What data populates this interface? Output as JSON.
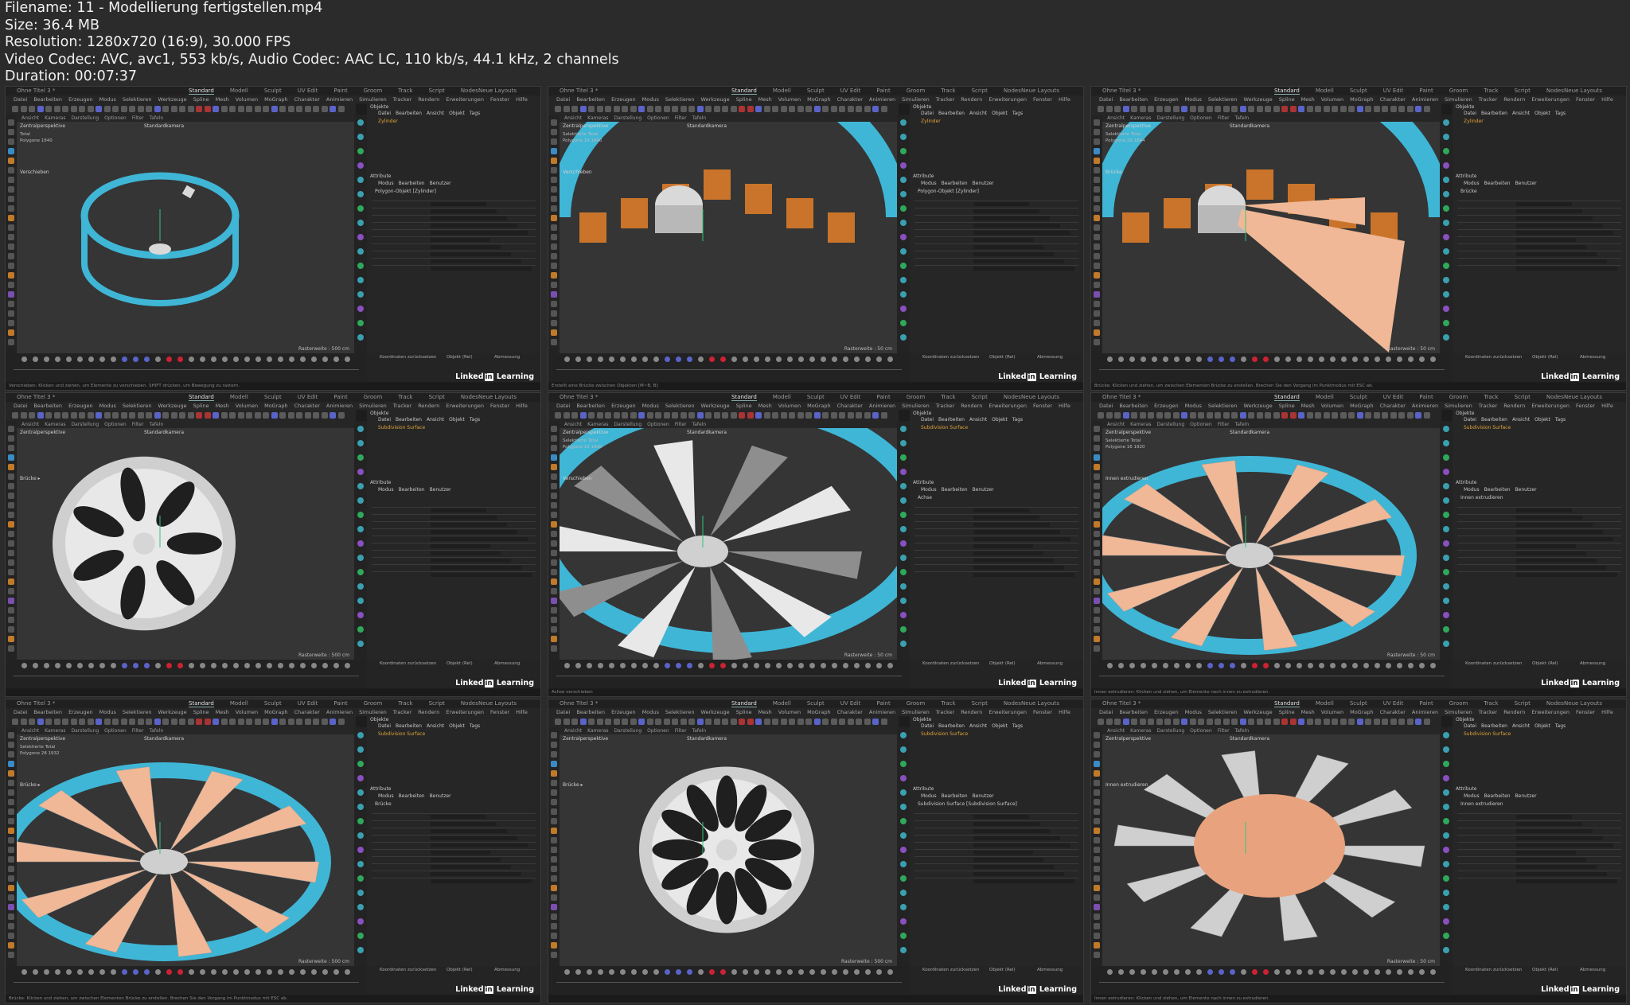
{
  "file_info": {
    "filename": "Filename: 11 - Modellierung fertigstellen.mp4",
    "size": "Size: 36.4 MB",
    "resolution": "Resolution: 1280x720 (16:9), 30.000 FPS",
    "codec": "Video Codec: AVC, avc1, 553 kb/s, Audio Codec: AAC LC, 110 kb/s, 44.1 kHz, 2 channels",
    "duration": "Duration: 00:07:37"
  },
  "ui": {
    "doc_tab": "Ohne Titel 3 *",
    "workspaces": [
      "Standard",
      "Modell",
      "Sculpt",
      "UV Edit",
      "Paint",
      "Groom",
      "Track",
      "Script",
      "Nodes"
    ],
    "new_layouts": "Neue Layouts",
    "menu": [
      "Datei",
      "Bearbeiten",
      "Erzeugen",
      "Modus",
      "Selektieren",
      "Werkzeuge",
      "Spline",
      "Mesh",
      "Volumen",
      "MoGraph",
      "Charakter",
      "Animieren",
      "Simulieren",
      "Tracker",
      "Rendern",
      "Erweiterungen",
      "Fenster",
      "Hilfe"
    ],
    "viewport_menu": [
      "Ansicht",
      "Kameras",
      "Darstellung",
      "Optionen",
      "Filter",
      "Tafeln"
    ],
    "view_name": "Zentralperspektive",
    "camera_name": "Standardkamera",
    "objects_tab": "Objekte",
    "obj_menu": [
      "Datei",
      "Bearbeiten",
      "Ansicht",
      "Objekt",
      "Tags"
    ],
    "attributes_tab": "Attribute",
    "attr_menu": [
      "Modus",
      "Bearbeiten",
      "Benutzer"
    ],
    "coords_reset": "Koordinaten zurücksetzen",
    "coords_mode": "Objekt (Rel)",
    "coords_size": "Abmessung",
    "brand_a": "Linked",
    "brand_b": "in",
    "brand_c": " Learning"
  },
  "cells": [
    {
      "object": "Zylinder",
      "raster": "Rasterweite : 500 cm",
      "stat_a": "Total",
      "stat_b": "Polygone  1840",
      "tool_label": "Verschieben",
      "attr_title": "Polygon-Objekt [Zylinder]",
      "status": "Verschieben: Klicken und ziehen, um Elemente zu verschieben. SHIFT drücken, um Bewegung zu rastern."
    },
    {
      "object": "Zylinder",
      "raster": "Rasterweite : 50 cm",
      "stat_a": "Selektierte  Total",
      "stat_b": "Polygone  16  1840",
      "tool_label": "Verschieben",
      "attr_title": "Polygon-Objekt [Zylinder]",
      "status": "Erstellt eine Brücke zwischen Objekten [M~B, B]"
    },
    {
      "object": "Zylinder",
      "raster": "Rasterweite : 50 cm",
      "stat_a": "Selektierte  Total",
      "stat_b": "Polygone  16  1844",
      "tool_label": "Brücke",
      "attr_title": "Brücke",
      "status": "Brücke: Klicken und ziehen, um zwischen Elementen Brücke zu erstellen. Brechen Sie den Vorgang im Punktmodus mit ESC ab."
    },
    {
      "object": "Subdivision Surface",
      "raster": "Rasterweite : 500 cm",
      "stat_a": "",
      "stat_b": "",
      "tool_label": "Brücke  ▸",
      "attr_title": "",
      "status": ""
    },
    {
      "object": "Subdivision Surface",
      "raster": "Rasterweite : 50 cm",
      "stat_a": "Selektierte  Total",
      "stat_b": "Polygone  16  1920",
      "tool_label": "Verschieben",
      "attr_title": "Achse",
      "status": "Achse verschieben"
    },
    {
      "object": "Subdivision Surface",
      "raster": "Rasterweite : 50 cm",
      "stat_a": "Selektierte  Total",
      "stat_b": "Polygone  16  1920",
      "tool_label": "Innen extrudieren",
      "attr_title": "Innen extrudieren",
      "status": "Innen extrudieren: Klicken und ziehen, um Elemente nach innen zu extrudieren."
    },
    {
      "object": "Subdivision Surface",
      "raster": "Rasterweite : 500 cm",
      "stat_a": "Selektierte  Total",
      "stat_b": "Polygone  28  1932",
      "tool_label": "Brücke  ▸",
      "attr_title": "Brücke",
      "status": "Brücke: Klicken und ziehen, um zwischen Elementen Brücke zu erstellen. Brechen Sie den Vorgang im Punktmodus mit ESC ab."
    },
    {
      "object": "Subdivision Surface",
      "raster": "Rasterweite : 500 cm",
      "stat_a": "",
      "stat_b": "",
      "tool_label": "Brücke  ▸",
      "attr_title": "Subdivision Surface [Subdivision Surface]",
      "status": ""
    },
    {
      "object": "Subdivision Surface",
      "raster": "Rasterweite : 50 cm",
      "stat_a": "",
      "stat_b": "",
      "tool_label": "Innen extrudieren",
      "attr_title": "Innen extrudieren",
      "status": "Innen extrudieren: Klicken und ziehen, um Elemente nach innen zu extrudieren."
    }
  ],
  "colors": {
    "bg": "#2b2b2b",
    "viewport": "#353535",
    "accent_teal": "#3fb6d6",
    "accent_orange": "#c9742a",
    "accent_purple": "#5a63c8"
  }
}
